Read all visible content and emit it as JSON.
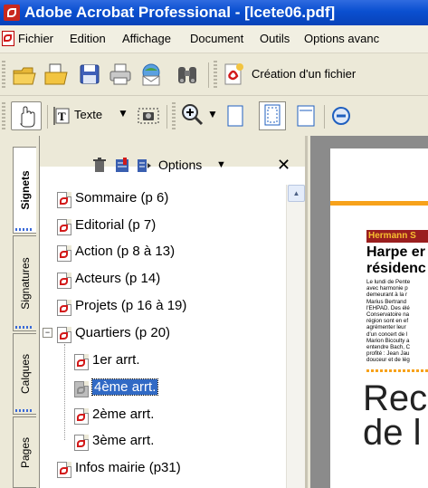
{
  "window": {
    "title": "Adobe Acrobat Professional - [lcete06.pdf]"
  },
  "menu": [
    "Fichier",
    "Edition",
    "Affichage",
    "Document",
    "Outils",
    "Options avanc"
  ],
  "toolbar1": {
    "create_label": "Création d'un fichier"
  },
  "toolbar2": {
    "text_tool_label": "Texte"
  },
  "nav_tabs": [
    "Signets",
    "Signatures",
    "Calques",
    "Pages"
  ],
  "bookmarks_panel": {
    "options_label": "Options",
    "items": [
      {
        "label": "Sommaire (p 6)",
        "level": 0
      },
      {
        "label": "Editorial (p 7)",
        "level": 0
      },
      {
        "label": "Action (p 8 à 13)",
        "level": 0
      },
      {
        "label": "Acteurs (p 14)",
        "level": 0
      },
      {
        "label": "Projets (p 16 à 19)",
        "level": 0
      },
      {
        "label": "Quartiers (p 20)",
        "level": 0,
        "expanded": true
      },
      {
        "label": "1er arrt.",
        "level": 1
      },
      {
        "label": "4ème arrt.",
        "level": 1,
        "selected": true
      },
      {
        "label": "2ème arrt.",
        "level": 1
      },
      {
        "label": "3ème arrt.",
        "level": 1
      },
      {
        "label": "Infos mairie (p31)",
        "level": 0
      }
    ]
  },
  "document": {
    "heading_author": "Hermann S",
    "headline_1": "Harpe er",
    "headline_2": "résidenc",
    "body_lines": [
      "Le lundi de Pente",
      "avec harmonie p",
      "demeurant à la r",
      "Marius Bertrand",
      "l'EHPAD. Des élé",
      "Conservatoire na",
      "région sont en ef",
      "agrémenter leur",
      "d'un concert de l",
      "Marion Bicoulty a",
      "entendre Bach, C",
      "profité : Jean Jau",
      "douceur et de lég"
    ],
    "big_title_1": "Rec",
    "big_title_2": "de l"
  },
  "colors": {
    "accent": "#F7A21B",
    "selection": "#316AC5",
    "pdf_red": "#D21A1A",
    "header_bg": "#9A1F1F"
  }
}
